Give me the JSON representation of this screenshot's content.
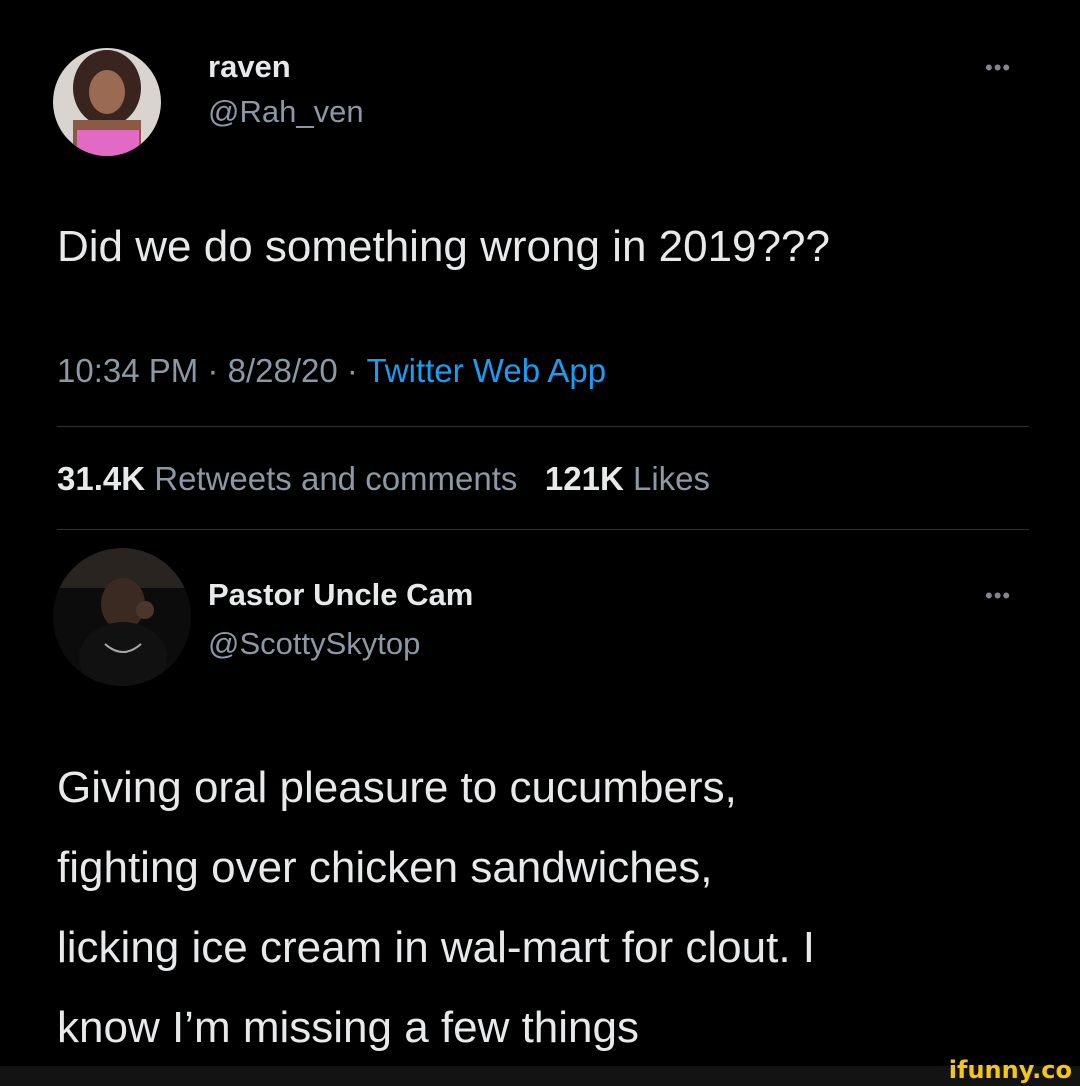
{
  "tweet": {
    "author_name": "raven",
    "author_handle": "@Rah_ven",
    "text": "Did we do something wrong in 2019???",
    "time": "10:34 PM",
    "date": "8/28/20",
    "separator": "·",
    "source": "Twitter Web App",
    "retweets_count": "31.4K",
    "retweets_label": "Retweets and comments",
    "likes_count": "121K",
    "likes_label": "Likes",
    "more_icon": "more-icon"
  },
  "reply": {
    "author_name": "Pastor Uncle Cam",
    "author_handle": "@ScottySkytop",
    "text_lines": [
      "Giving oral pleasure to cucumbers,",
      "fighting over chicken sandwiches,",
      "licking ice cream in wal-mart for clout. I",
      "know I’m missing a few things"
    ]
  },
  "watermark": "ifunny.co",
  "colors": {
    "background": "#000000",
    "text": "#e7e9ea",
    "secondary": "#8b98a5",
    "link": "#1d9bf0",
    "divider": "#2f3336"
  }
}
